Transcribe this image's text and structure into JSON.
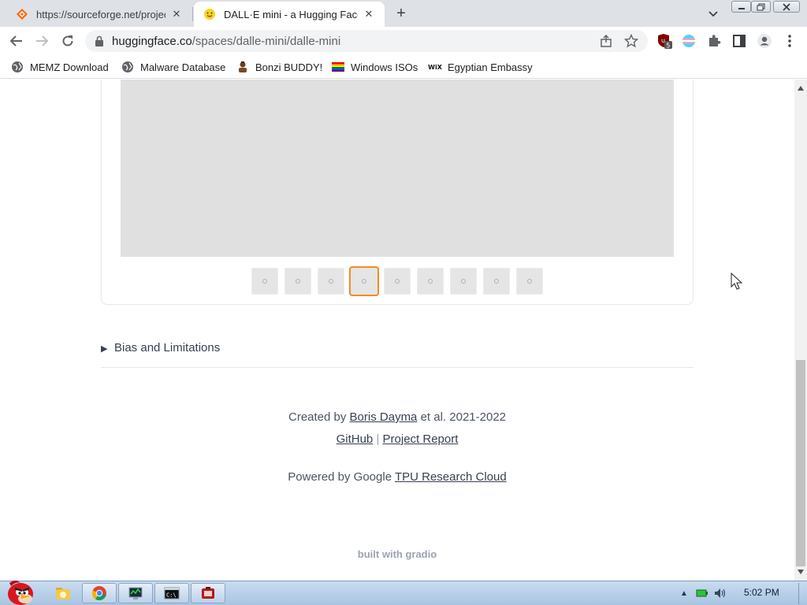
{
  "browser": {
    "tabs": [
      {
        "title": "https://sourceforge.net/projec",
        "active": false
      },
      {
        "title": "DALL·E mini - a Hugging Face",
        "active": true
      }
    ],
    "new_tab_label": "+",
    "window_controls": {
      "minimize": "minimize-icon",
      "maximize": "maximize-icon",
      "close": "close-icon"
    },
    "url": {
      "host": "huggingface.co",
      "path": "/spaces/dalle-mini/dalle-mini"
    },
    "extension_badge": "5",
    "bookmarks": [
      {
        "label": "MEMZ Download",
        "icon": "globe-icon"
      },
      {
        "label": "Malware Database",
        "icon": "globe-icon"
      },
      {
        "label": "Bonzi BUDDY!",
        "icon": "bonzi-icon"
      },
      {
        "label": "Windows ISOs",
        "icon": "rainbow-flag-icon"
      },
      {
        "label": "Egyptian Embassy",
        "icon": "wix-icon"
      }
    ]
  },
  "page": {
    "gallery": {
      "thumbnail_count": 9,
      "selected_index": 3,
      "accent": "#f28b20"
    },
    "details_label": "Bias and Limitations",
    "footer": {
      "created_by_prefix": "Created by",
      "author_link": "Boris Dayma",
      "created_by_suffix": "et al. 2021-2022",
      "github_link": "GitHub",
      "separator": "|",
      "report_link": "Project Report",
      "powered_prefix": "Powered by Google",
      "tpu_link": "TPU Research Cloud"
    },
    "built_with": "built with gradio"
  },
  "taskbar": {
    "clock": "5:02 PM",
    "items": [
      "explorer-icon",
      "chrome-icon",
      "task-manager-icon",
      "cmd-icon",
      "app-icon"
    ]
  },
  "colors": {
    "tabstrip": "#dee1e6",
    "taskbar": "#b9d1ea",
    "preview_bg": "#e0e0e0"
  }
}
